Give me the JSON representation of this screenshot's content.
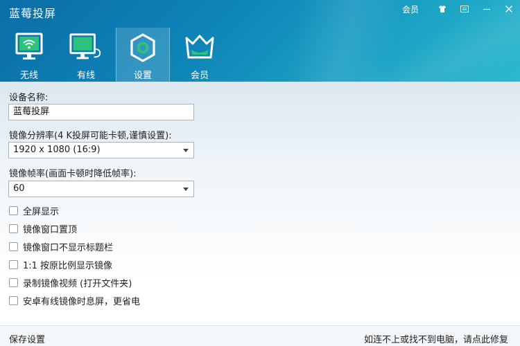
{
  "app": {
    "title": "蓝莓投屏"
  },
  "window_controls": {
    "member_label": "会员"
  },
  "tabs": [
    {
      "label": "无线",
      "icon": "wifi-monitor-icon"
    },
    {
      "label": "有线",
      "icon": "cable-monitor-icon"
    },
    {
      "label": "设置",
      "icon": "settings-hex-icon"
    },
    {
      "label": "会员",
      "icon": "crown-icon"
    }
  ],
  "active_tab": "设置",
  "settings": {
    "device_name_label": "设备名称:",
    "device_name_value": "蓝莓投屏",
    "resolution_label": "镜像分辨率(4 K投屏可能卡顿,谨慎设置):",
    "resolution_value": "1920 x 1080 (16:9)",
    "framerate_label": "镜像帧率(画面卡顿时降低帧率):",
    "framerate_value": "60"
  },
  "checkboxes": [
    {
      "label": "全屏显示",
      "checked": false
    },
    {
      "label": "镜像窗口置顶",
      "checked": false
    },
    {
      "label": "镜像窗口不显示标题栏",
      "checked": false
    },
    {
      "label": "1:1 按原比例显示镜像",
      "checked": false
    },
    {
      "label": "录制镜像视频 (打开文件夹)",
      "checked": false
    },
    {
      "label": "安卓有线镜像时息屏，更省电",
      "checked": false
    }
  ],
  "footer": {
    "save_label": "保存设置",
    "repair_label": "如连不上或找不到电脑，请点此修复"
  },
  "colors": {
    "header_start": "#0b6ea6",
    "header_end": "#2cb9cc",
    "accent_green": "#2ec27e"
  }
}
